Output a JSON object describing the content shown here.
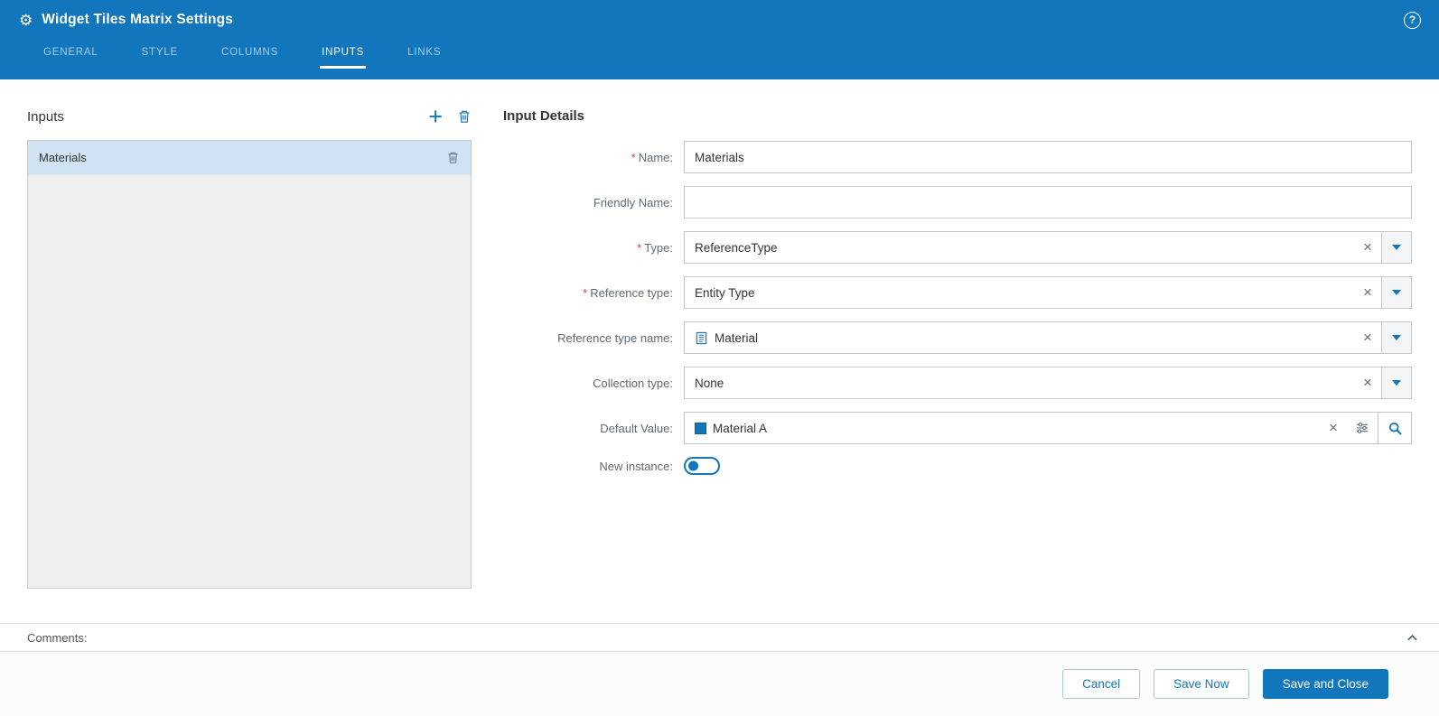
{
  "header": {
    "title": "Widget Tiles Matrix Settings"
  },
  "tabs": [
    {
      "label": "GENERAL",
      "active": false
    },
    {
      "label": "STYLE",
      "active": false
    },
    {
      "label": "COLUMNS",
      "active": false
    },
    {
      "label": "INPUTS",
      "active": true
    },
    {
      "label": "LINKS",
      "active": false
    }
  ],
  "inputs_panel": {
    "title": "Inputs",
    "items": [
      {
        "label": "Materials",
        "selected": true
      }
    ]
  },
  "details": {
    "title": "Input Details",
    "required_marker": "*",
    "fields": {
      "name": {
        "label": "Name:",
        "required": true,
        "value": "Materials"
      },
      "friendly_name": {
        "label": "Friendly Name:",
        "required": false,
        "value": ""
      },
      "type": {
        "label": "Type:",
        "required": true,
        "value": "ReferenceType"
      },
      "reference_type": {
        "label": "Reference type:",
        "required": true,
        "value": "Entity Type"
      },
      "reference_type_name": {
        "label": "Reference type name:",
        "required": false,
        "value": "Material"
      },
      "collection_type": {
        "label": "Collection type:",
        "required": false,
        "value": "None"
      },
      "default_value": {
        "label": "Default Value:",
        "required": false,
        "value": "Material A"
      },
      "new_instance": {
        "label": "New instance:",
        "required": false,
        "value": "off"
      }
    }
  },
  "comments": {
    "label": "Comments:"
  },
  "footer": {
    "cancel_label": "Cancel",
    "save_now_label": "Save Now",
    "save_and_close_label": "Save and Close"
  },
  "icons": {
    "gear": "⚙",
    "help": "?",
    "add": "+",
    "clear": "×",
    "trash": "trash-icon",
    "dropdown": "chevron-down-icon",
    "reference_document": "document-list-icon",
    "sliders": "filter-sliders-icon",
    "search": "magnifier-icon",
    "collapse": "chevron-up-icon"
  },
  "colors": {
    "header_blue": "#1276bc",
    "accent_blue": "#1276bc",
    "selected_item_bg": "#cfe3f4",
    "required_red": "#d0453e",
    "list_bg": "#efefef"
  }
}
